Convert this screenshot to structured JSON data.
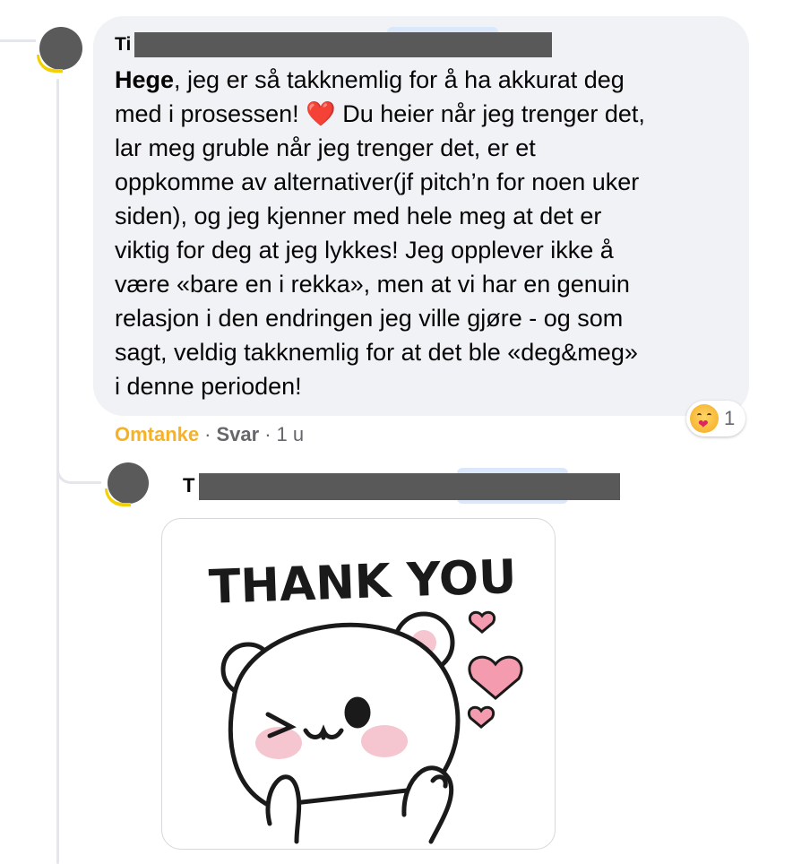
{
  "comment": {
    "author_initial": "Ti",
    "mention": "Hege",
    "text_lines": [
      ", jeg er så takknemlig for å ha akkurat deg",
      "med i prosessen! ",
      " Du heier når jeg trenger det,",
      "lar meg gruble når jeg trenger det, er et",
      "oppkomme av alternativer(jf pitch’n for noen uker",
      "siden), og jeg kjenner med hele meg at det er",
      "viktig for deg at jeg lykkes! Jeg opplever ikke å",
      "være «bare en i rekka», men at vi har en genuin",
      "relasjon i den endringen jeg ville gjøre - og som",
      "sagt, veldig takknemlig for at det ble «deg&meg»",
      "i denne perioden!"
    ],
    "heart_emoji": "❤️",
    "reaction_count": "1",
    "care_label": "Omtanke",
    "separator": "·",
    "reply_label": "Svar",
    "time_ago": "1 u"
  },
  "reply": {
    "author_initial": "T",
    "sticker_text": "THANK YOU"
  },
  "colors": {
    "bubble_bg": "#f0f2f5",
    "care_color": "#f7b125",
    "meta_gray": "#65676b",
    "redaction": "#595959"
  }
}
